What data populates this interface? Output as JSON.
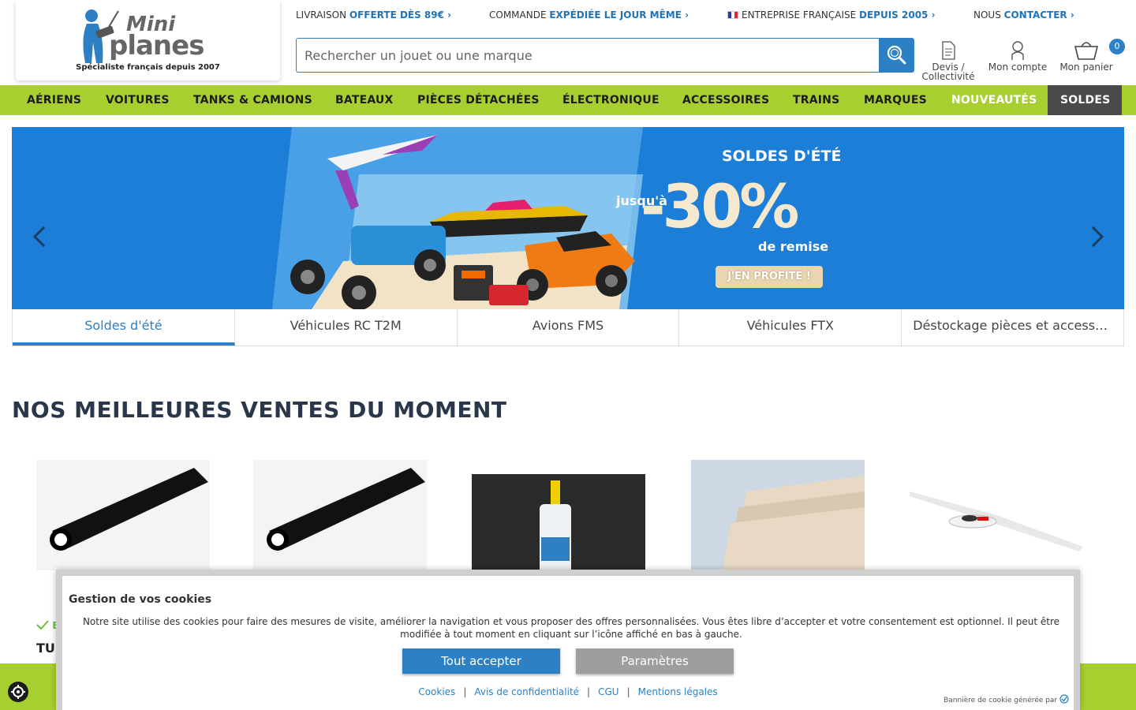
{
  "header": {
    "logo_word1": "Mini",
    "logo_word2": "planes",
    "logo_tagline": "Spécialiste français depuis 2007",
    "topbar": [
      {
        "pre": "LIVRAISON ",
        "hl": "OFFERTE DÈS 89€ ›"
      },
      {
        "pre": "COMMANDE ",
        "hl": "EXPÉDIÉE LE JOUR MÊME ›"
      },
      {
        "pre": "ENTREPRISE FRANÇAISE ",
        "hl": "DEPUIS 2005 ›"
      },
      {
        "pre": "NOUS ",
        "hl": "CONTACTER ›"
      }
    ],
    "search_placeholder": "Rechercher un jouet ou une marque",
    "devis_label_1": "Devis /",
    "devis_label_2": "Collectivité",
    "account_label": "Mon compte",
    "cart_label": "Mon panier",
    "cart_count": "0"
  },
  "nav": [
    "AÉRIENS",
    "VOITURES",
    "TANKS & CAMIONS",
    "BATEAUX",
    "PIÈCES DÉTACHÉES",
    "ÉLECTRONIQUE",
    "ACCESSOIRES",
    "TRAINS",
    "MARQUES",
    "NOUVEAUTÉS",
    "SOLDES"
  ],
  "banner": {
    "headline": "SOLDES D'ÉTÉ",
    "upto": "jusqu'à",
    "percent": "-30%",
    "sub": "de remise",
    "cta": "J'EN PROFITE !"
  },
  "tabs": [
    "Soldes d'été",
    "Véhicules RC T2M",
    "Avions FMS",
    "Véhicules FTX",
    "Déstockage pièces et accessoires"
  ],
  "section_title": "NOS MEILLEURES VENTES DU MOMENT",
  "product_stock_fragment": "E",
  "product_title_fragment": "TU",
  "cookie": {
    "title": "Gestion de vos cookies",
    "text": "Notre site utilise des cookies pour faire des mesures de visite, améliorer la navigation et vous proposer des offres personnalisées. Vous êtes libre d’accepter et votre consentement est optionnel. Il peut être modifiée à tout moment en cliquant sur l’icône affiché en bas à gauche.",
    "accept_label": "Tout accepter",
    "params_label": "Paramètres",
    "links": [
      "Cookies",
      "Avis de confidentialité",
      "CGU",
      "Mentions légales"
    ],
    "credit": "Bannière de cookie générée par"
  }
}
